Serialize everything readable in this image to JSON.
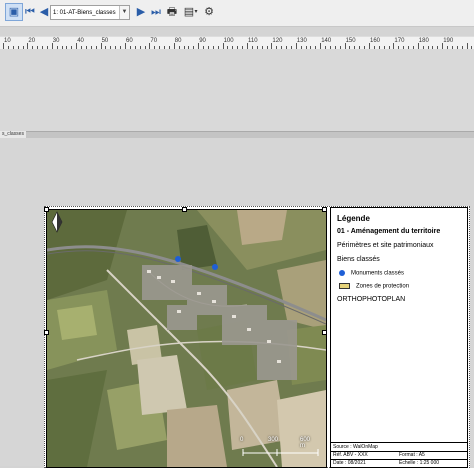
{
  "toolbar": {
    "page_select": "1: 01-AT-Biens_classes",
    "icons": [
      "view-page-icon",
      "first-page-icon",
      "prev-page-icon",
      "next-page-icon",
      "last-page-icon",
      "print-icon",
      "export-icon",
      "atlas-settings-icon"
    ]
  },
  "ruler": {
    "ticks": [
      "10",
      "20",
      "30",
      "40",
      "50",
      "60",
      "70",
      "80",
      "90",
      "100",
      "110",
      "120",
      "130",
      "140",
      "150",
      "160",
      "170",
      "180",
      "190"
    ]
  },
  "splitter": {
    "tab_label": "s_classes"
  },
  "legend": {
    "title": "Légende",
    "line1": "01 - Aménagement du territoire",
    "line2": "Périmètres et site patrimoniaux",
    "line3": "Biens classés",
    "items": [
      {
        "label": "Monuments classés",
        "symbol": "blue-dot"
      },
      {
        "label": "Zones de protection",
        "symbol": "zone-box"
      }
    ],
    "basemap": "ORTHOPHOTOPLAN"
  },
  "info": {
    "source": "Source : WalOnMap",
    "ref": "Réf. ABV - XXX",
    "format": "Format : A5",
    "date": "Date : 08/2021",
    "scale": "Échelle : 1:25 000"
  },
  "scalebar": {
    "labels": [
      "0",
      "300",
      "600 m"
    ]
  },
  "colors": {
    "monument": "#1f5fd6",
    "toolbar_accent": "#2a5da8"
  }
}
